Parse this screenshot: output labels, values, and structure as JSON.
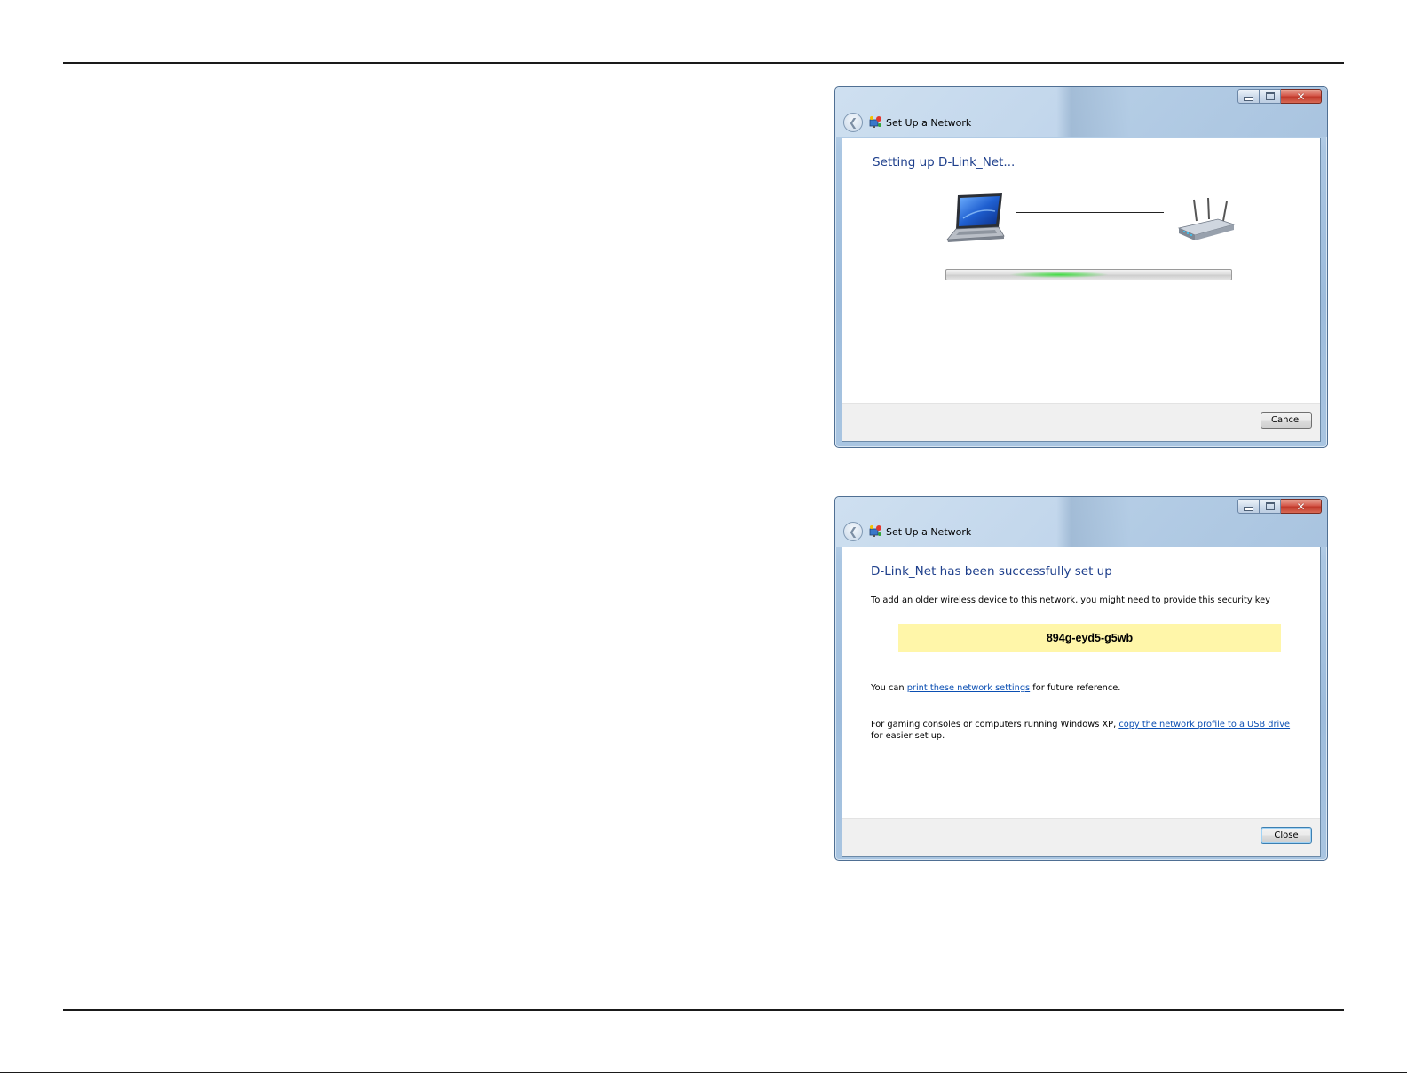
{
  "dialog_setting_up": {
    "window_title": "Set Up a Network",
    "heading": "Setting up D-Link_Net...",
    "cancel_label": "Cancel"
  },
  "dialog_success": {
    "window_title": "Set Up a Network",
    "heading": "D-Link_Net has been successfully set up",
    "intro_text": "To add an older wireless device to this network, you might need to provide this security key",
    "security_key": "894g-eyd5-g5wb",
    "print_prefix": "You can ",
    "print_link": "print these network settings",
    "print_suffix": " for future reference.",
    "usb_prefix": "For gaming consoles or computers running Windows XP, ",
    "usb_link": "copy the network profile to a USB drive",
    "usb_suffix": " for easier set up.",
    "close_label": "Close"
  },
  "icons": {
    "back": "back-arrow-icon",
    "network": "network-wizard-icon",
    "laptop": "laptop-icon",
    "router": "wireless-router-icon"
  },
  "colors": {
    "heading_blue": "#1e3f8c",
    "link_blue": "#0b4fb3",
    "key_highlight": "#fff6a9",
    "progress_green": "#3fdd42"
  }
}
